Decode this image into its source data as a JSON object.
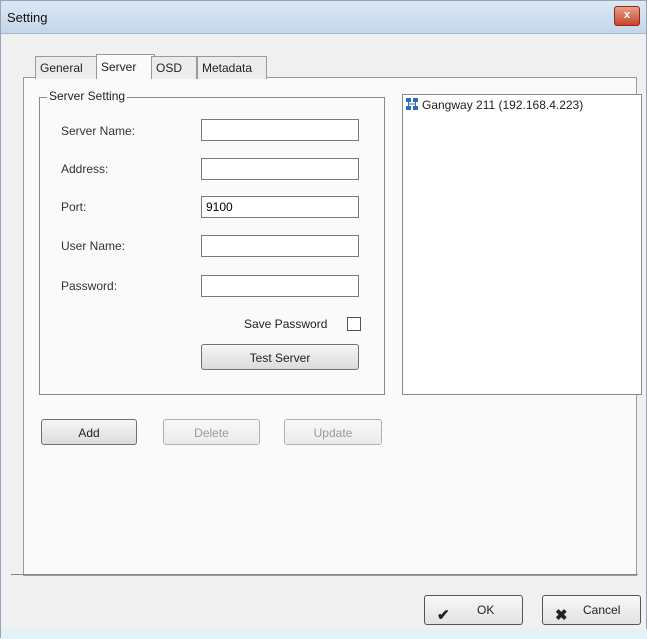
{
  "window": {
    "title": "Setting",
    "close_label": "x"
  },
  "tabs": [
    {
      "label": "General"
    },
    {
      "label": "Server"
    },
    {
      "label": "OSD"
    },
    {
      "label": "Metadata"
    }
  ],
  "active_tab": "Server",
  "server_setting": {
    "group_label": "Server Setting",
    "server_name": {
      "label": "Server Name:",
      "value": ""
    },
    "address": {
      "label": "Address:",
      "value": ""
    },
    "port": {
      "label": "Port:",
      "value": "9100"
    },
    "user_name": {
      "label": "User Name:",
      "value": ""
    },
    "password": {
      "label": "Password:",
      "value": ""
    },
    "save_password": {
      "label": "Save Password",
      "checked": false
    },
    "test_server_label": "Test Server"
  },
  "actions": {
    "add": "Add",
    "delete": "Delete",
    "update": "Update"
  },
  "server_tree": {
    "items": [
      {
        "label": "Gangway 211 (192.168.4.223)",
        "icon": "network-server-icon"
      }
    ]
  },
  "footer": {
    "ok": "OK",
    "cancel": "Cancel"
  }
}
